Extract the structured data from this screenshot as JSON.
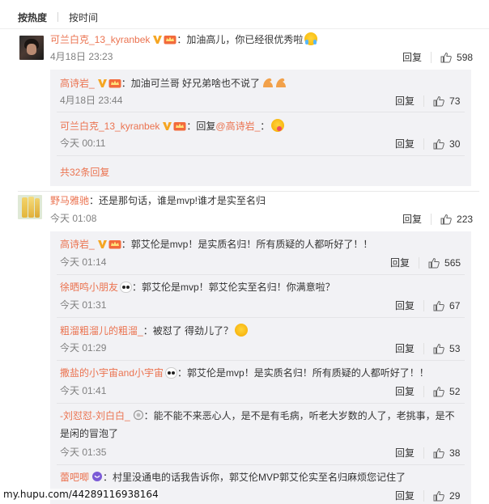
{
  "sort": {
    "hot": "按热度",
    "time": "按时间"
  },
  "colors": {
    "name": "#eb7350",
    "time": "#808080",
    "reply_bg": "#f2f2f5"
  },
  "comments": [
    {
      "name": "可兰白克_13_kyranbek",
      "text": "：加油高儿，你已经很优秀啦",
      "time": "4月18日 23:23",
      "reply": "回复",
      "likes": "598",
      "emoji": "crying-face",
      "replies": [
        {
          "name": "高诗岩_",
          "text": "：加油可兰哥 好兄弟啥也不说了",
          "time": "4月18日 23:44",
          "reply": "回复",
          "likes": "73",
          "emoji": "flexed-biceps"
        },
        {
          "name": "可兰白克_13_kyranbek",
          "text": "：回复",
          "at": "@高诗岩_",
          "text2": "：",
          "time": "今天 00:11",
          "reply": "回复",
          "likes": "30",
          "emoji": "tongue-face"
        }
      ],
      "more": "共32条回复"
    },
    {
      "name": "野马雅驰",
      "text": "：还是那句话，谁是mvp!谁才是实至名归",
      "time": "今天 01:08",
      "reply": "回复",
      "likes": "223",
      "replies": [
        {
          "name": "高诗岩_",
          "text": "：郭艾伦是mvp！是实质名归！所有质疑的人都听好了！！",
          "time": "今天 01:14",
          "reply": "回复",
          "likes": "565"
        },
        {
          "name": "徐晒鸣小朋友",
          "text": "：郭艾伦是mvp！郭艾伦实至名归！你满意啦？",
          "time": "今天 01:31",
          "reply": "回复",
          "likes": "67",
          "emoji": "panda"
        },
        {
          "name": "粗溜粗溜儿的粗溜_",
          "text": "：被怼了 得劲儿了？",
          "time": "今天 01:29",
          "reply": "回复",
          "likes": "53",
          "emoji": "grin-face"
        },
        {
          "name": "撒盐的小宇宙and小宇宙",
          "text": "：郭艾伦是mvp！是实质名归！所有质疑的人都听好了！！",
          "time": "今天 01:41",
          "reply": "回复",
          "likes": "52",
          "emoji": "panda"
        },
        {
          "name": "-刘怼怼-刘白白_",
          "text": "：能不能不来恶心人，是不是有毛病，听老大岁数的人了，老挑事，是不",
          "text_line2": "是闲的冒泡了",
          "time": "今天 01:35",
          "reply": "回复",
          "likes": "38"
        },
        {
          "name": "蕾吧唧",
          "text": "：村里没通电的话我告诉你，郭艾伦MVP郭艾伦实至名归麻烦您记住了",
          "time": "",
          "reply": "回复",
          "likes": "29"
        }
      ]
    }
  ],
  "watermark": "my.hupu.com/44289116938164"
}
